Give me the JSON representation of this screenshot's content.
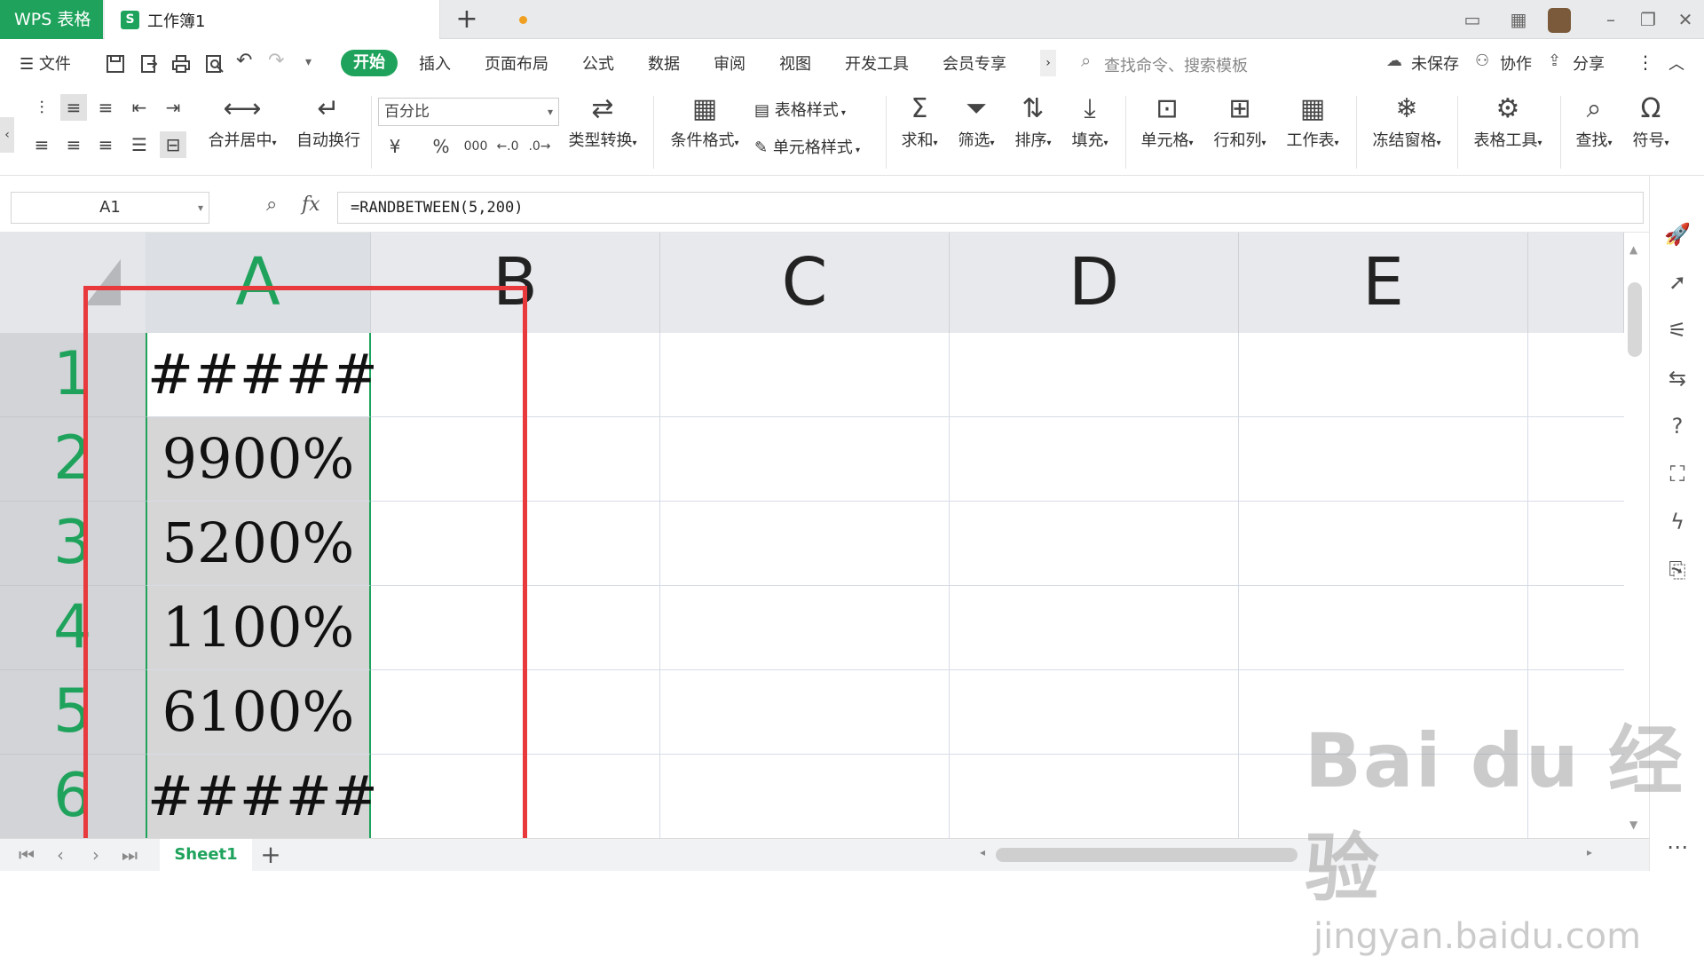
{
  "titlebar": {
    "app_tab": "WPS 表格",
    "doc_tab_icon": "S",
    "doc_tab_title": "工作簿1",
    "new_tab": "+"
  },
  "menubar": {
    "file": "文件",
    "tabs": [
      "开始",
      "插入",
      "页面布局",
      "公式",
      "数据",
      "审阅",
      "视图",
      "开发工具",
      "会员专享"
    ],
    "search_placeholder": "查找命令、搜索模板",
    "unsaved": "未保存",
    "collab": "协作",
    "share": "分享"
  },
  "toolbar": {
    "merge_center": "合并居中",
    "auto_wrap": "自动换行",
    "number_format": "百分比",
    "currency": "¥",
    "percent": "%",
    "thousands": "000",
    "type_convert": "类型转换",
    "cond_format": "条件格式",
    "table_style": "表格样式",
    "cell_style": "单元格样式",
    "sum": "求和",
    "filter": "筛选",
    "sort": "排序",
    "fill": "填充",
    "cell": "单元格",
    "row_col": "行和列",
    "worksheet": "工作表",
    "freeze": "冻结窗格",
    "table_tools": "表格工具",
    "find": "查找",
    "symbol": "符号"
  },
  "formula_bar": {
    "name_box": "A1",
    "fx": "fx",
    "formula": "=RANDBETWEEN(5,200)"
  },
  "grid": {
    "columns": [
      "A",
      "B",
      "C",
      "D",
      "E"
    ],
    "rows": [
      "1",
      "2",
      "3",
      "4",
      "5",
      "6"
    ],
    "col_a_values": [
      "#####",
      "9900%",
      "5200%",
      "1100%",
      "6100%",
      "#####"
    ]
  },
  "sheetbar": {
    "sheet_name": "Sheet1",
    "add": "+"
  },
  "watermark": {
    "brand": "Bai du 经验",
    "url": "jingyan.baidu.com"
  },
  "colors": {
    "accent": "#1fa35c",
    "highlight_box": "#e8393d"
  }
}
